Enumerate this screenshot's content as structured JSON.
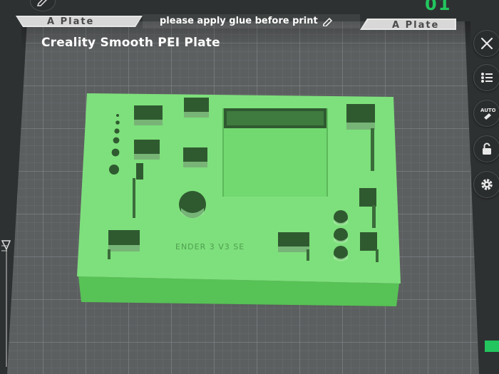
{
  "plate": {
    "name": "Creality Smooth PEI Plate",
    "tab_left_label": "A Plate",
    "tab_right_label": "A Plate",
    "note": "please apply glue before print"
  },
  "top_counter": "01",
  "model": {
    "embossed_text": "ENDER 3 V3 SE"
  },
  "toolbar": {
    "close_icon": "close-icon",
    "list_icon": "list-icon",
    "auto_icon": "auto-arrange-icon",
    "auto_label": "AUTO",
    "lock_icon": "lock-icon",
    "settings_icon": "gear-icon"
  },
  "colors": {
    "model": "#7ee07c",
    "accent": "#22c55e",
    "bed": "#5f6263"
  }
}
